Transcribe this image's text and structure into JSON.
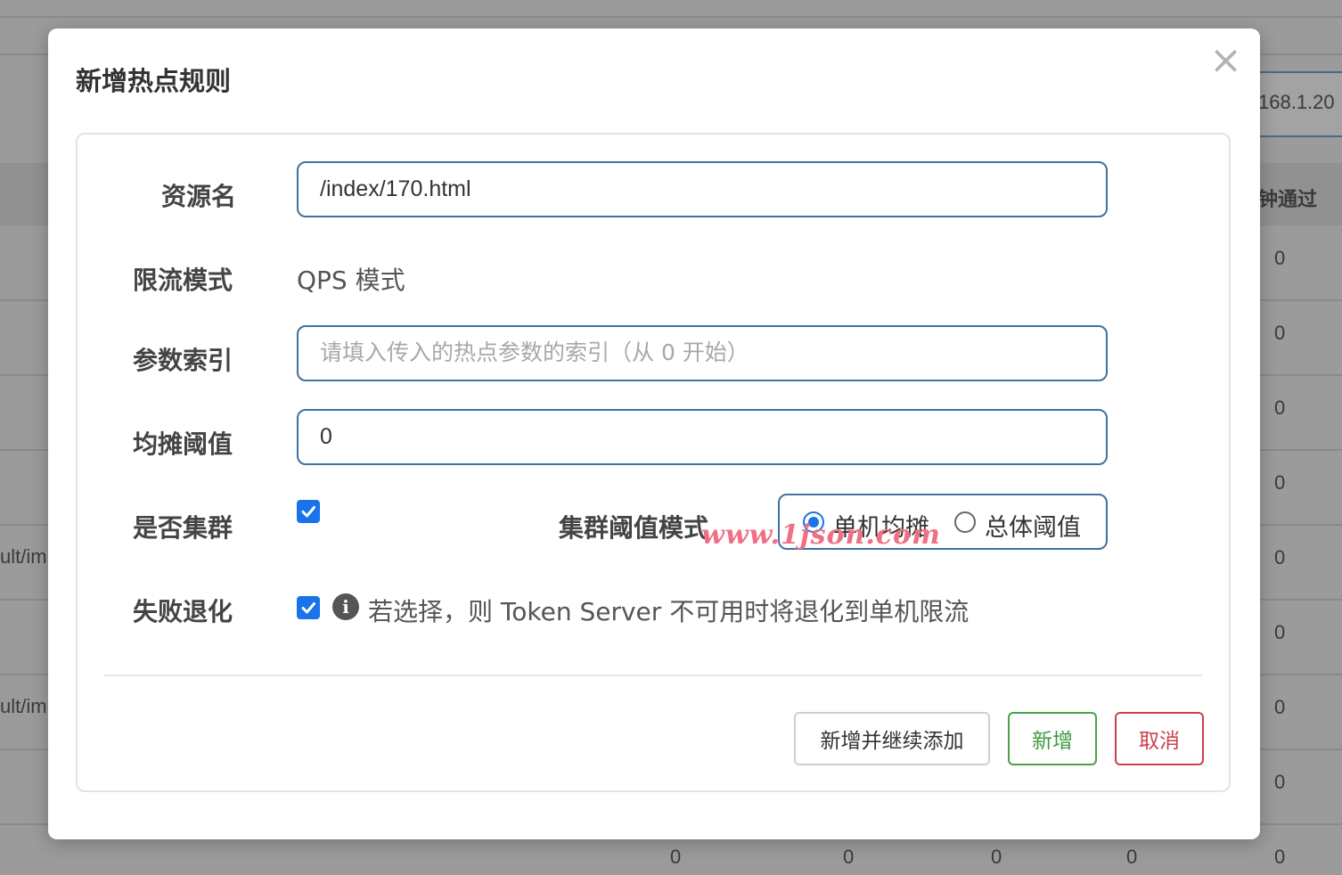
{
  "background": {
    "ip_fragment": "168.1.20",
    "column_header_fragment": "钟通过",
    "left_fragments": [
      "ult/im",
      "ult/im"
    ],
    "right_column_values": [
      "0",
      "0",
      "0",
      "0",
      "0",
      "0",
      "0",
      "0",
      "0"
    ],
    "bottom_row_values": [
      "0",
      "0",
      "0",
      "0",
      "0"
    ]
  },
  "modal": {
    "title": "新增热点规则",
    "close_symbol": "×",
    "fields": {
      "resource_name": {
        "label": "资源名",
        "value": "/index/170.html"
      },
      "limit_mode": {
        "label": "限流模式",
        "value": "QPS 模式"
      },
      "param_index": {
        "label": "参数索引",
        "value": "",
        "placeholder": "请填入传入的热点参数的索引（从 0 开始）"
      },
      "avg_threshold": {
        "label": "均摊阈值",
        "value": "0"
      },
      "cluster": {
        "label": "是否集群",
        "checked": true
      },
      "cluster_threshold_mode": {
        "label": "集群阈值模式",
        "options": [
          {
            "label": "单机均摊",
            "checked": true
          },
          {
            "label": "总体阈值",
            "checked": false
          }
        ]
      },
      "fallback": {
        "label": "失败退化",
        "checked": true,
        "help_text": "若选择，则 Token Server 不可用时将退化到单机限流"
      }
    },
    "buttons": {
      "add_continue": "新增并继续添加",
      "add": "新增",
      "cancel": "取消"
    },
    "watermark": "www.1json.com"
  }
}
